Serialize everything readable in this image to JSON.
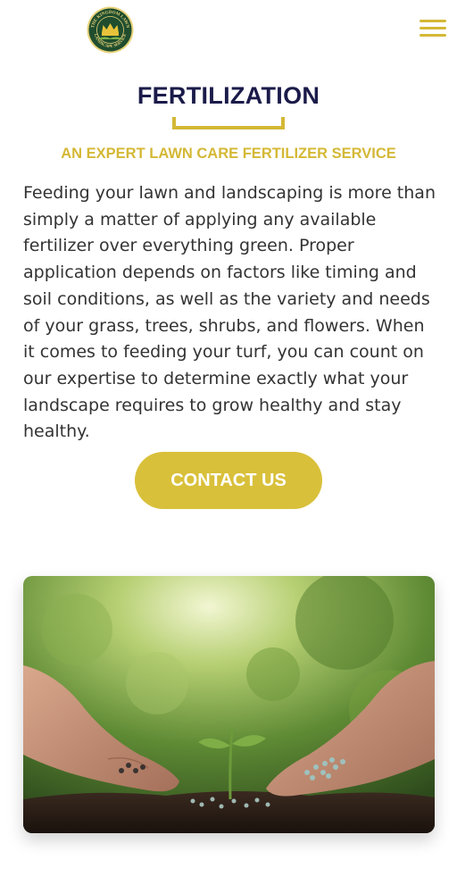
{
  "header": {
    "logo_text_top": "THE KINGDOM LAWN",
    "logo_text_bottom": "LANDSCAPE SERVICE",
    "menu_icon": "hamburger-menu-icon"
  },
  "section": {
    "title": "FERTILIZATION",
    "subtitle": "AN EXPERT LAWN CARE FERTILIZER SERVICE",
    "body": "Feeding your lawn and landscaping is more than simply a matter of applying any available fertilizer over everything green. Proper application depends on factors like timing and soil conditions, as well as the variety and needs of your grass, trees, shrubs, and flowers. When it comes to feeding your turf, you can count on our expertise to determine exactly what your landscape requires to grow healthy and stay healthy.",
    "cta_label": "CONTACT US"
  },
  "colors": {
    "accent": "#d4b836",
    "heading": "#1b1b4a",
    "text": "#333333",
    "logo_green": "#1f4d2e"
  }
}
